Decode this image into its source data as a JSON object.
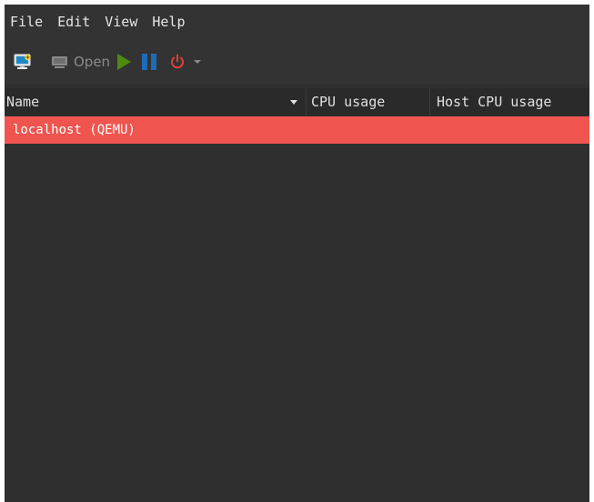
{
  "menubar": {
    "items": [
      "File",
      "Edit",
      "View",
      "Help"
    ]
  },
  "toolbar": {
    "new_vm_icon": "new-vm-icon",
    "open_label": "Open",
    "open_icon": "monitor-icon",
    "run_icon": "play-icon",
    "pause_icon": "pause-icon",
    "shutdown_icon": "power-icon",
    "shutdown_menu_icon": "chevron-down-icon"
  },
  "table": {
    "columns": [
      "Name",
      "CPU usage",
      "Host CPU usage"
    ],
    "sort_column": "Name",
    "rows": [
      {
        "name": "localhost (QEMU)",
        "cpu_usage": "",
        "host_cpu_usage": "",
        "selected": true
      }
    ]
  },
  "colors": {
    "selection": "#f0544f",
    "run_icon": "#4e8a0e",
    "pause_icon": "#1e6bb8",
    "shutdown_icon": "#e0413b",
    "background": "#2f2f2f"
  }
}
